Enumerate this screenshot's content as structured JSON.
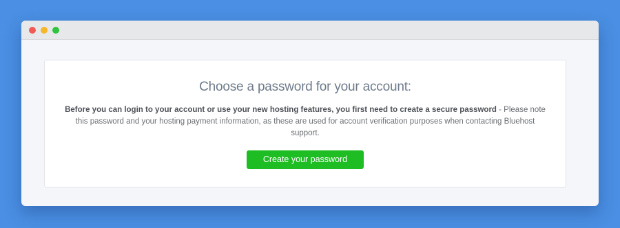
{
  "window": {
    "controls": {
      "close_color": "#f25b55",
      "minimize_color": "#f5b82b",
      "maximize_color": "#2ec43f"
    }
  },
  "card": {
    "heading": "Choose a password for your account:",
    "body_bold": "Before you can login to your account or use your new hosting features, you first need to create a secure password",
    "body_rest": " - Please note this password and your hosting payment information, as these are used for account verification purposes when contacting Bluehost support.",
    "cta_label": "Create your password"
  },
  "colors": {
    "background": "#4a8fe3",
    "cta": "#1ebd23",
    "heading": "#6f7b8a"
  }
}
